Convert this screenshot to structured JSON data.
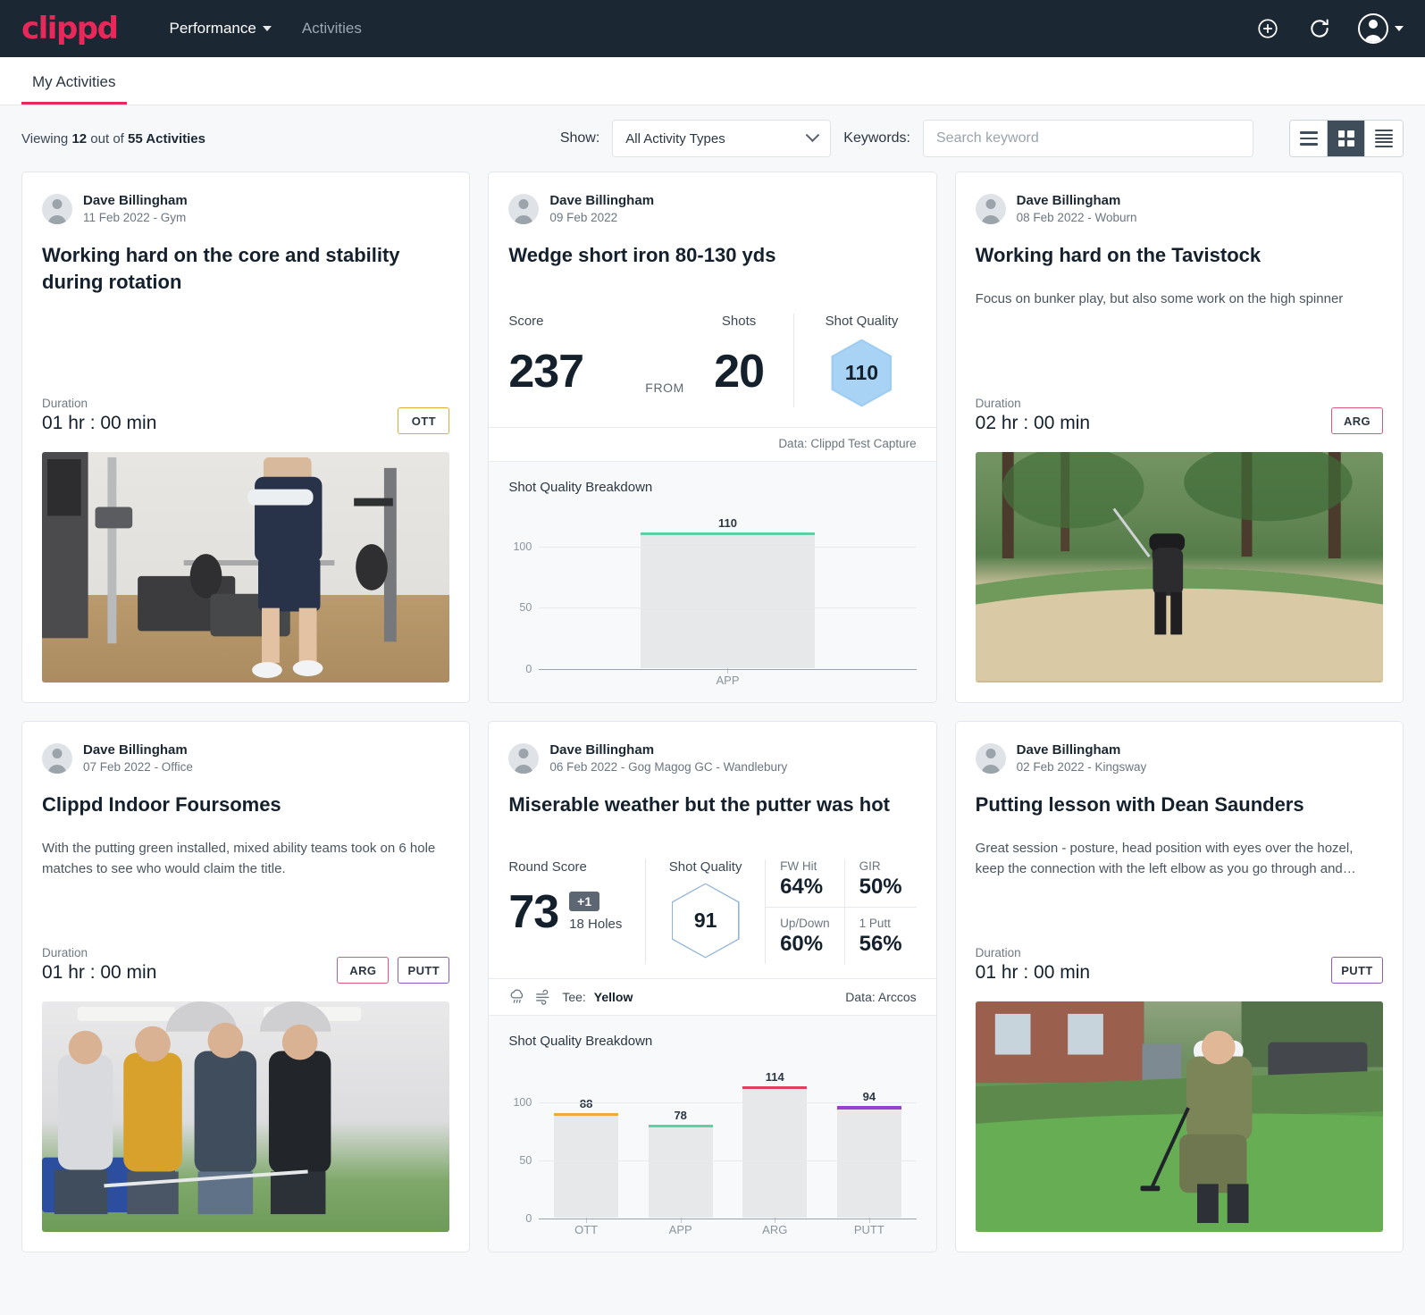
{
  "brand": {
    "logo_text": "clippd",
    "accent": "#e8275a",
    "navbar_bg": "#1b2733"
  },
  "topnav": {
    "links": [
      {
        "label": "Performance",
        "has_dropdown": true
      },
      {
        "label": "Activities",
        "has_dropdown": false
      }
    ],
    "actions": [
      {
        "name": "add-icon",
        "glyph": "plus-circle"
      },
      {
        "name": "refresh-icon",
        "glyph": "refresh"
      },
      {
        "name": "account-menu",
        "glyph": "avatar"
      }
    ]
  },
  "tabs": [
    {
      "label": "My Activities",
      "active": true
    }
  ],
  "filterbar": {
    "viewing_prefix": "Viewing",
    "viewing_count": "12",
    "viewing_mid": "out of",
    "viewing_total": "55 Activities",
    "show_label": "Show:",
    "activity_type_value": "All Activity Types",
    "keywords_label": "Keywords:",
    "search_placeholder": "Search keyword",
    "view_modes": [
      {
        "name": "list-view",
        "active": false
      },
      {
        "name": "grid-view",
        "active": true
      },
      {
        "name": "compact-list-view",
        "active": false
      }
    ]
  },
  "cards": [
    {
      "id": "card-core-stability",
      "author": "Dave Billingham",
      "meta": "11 Feb 2022 - Gym",
      "title": "Working hard on the core and stability during rotation",
      "description": "",
      "duration_label": "Duration",
      "duration_value": "01 hr : 00 min",
      "tags": [
        {
          "label": "OTT",
          "cls": "ott"
        }
      ],
      "photo": "gym",
      "layout": "media"
    },
    {
      "id": "card-wedge-short-iron",
      "author": "Dave Billingham",
      "meta": "09 Feb 2022",
      "title": "Wedge short iron 80-130 yds",
      "layout": "stats",
      "stats": {
        "score_label": "Score",
        "score_value": "237",
        "from_label": "FROM",
        "shots_label": "Shots",
        "shots_value": "20",
        "quality_label": "Shot Quality",
        "quality_value": "110"
      },
      "data_source": "Data: Clippd Test Capture",
      "chart_title": "Shot Quality Breakdown",
      "chart_data": {
        "type": "bar",
        "title": "Shot Quality Breakdown",
        "categories": [
          "APP"
        ],
        "values": [
          110
        ],
        "colors": [
          "#5fd0a5"
        ],
        "ylim": [
          0,
          125
        ],
        "yticks": [
          0,
          50,
          100
        ],
        "xlabel": "",
        "ylabel": "",
        "grid": true,
        "legend": "none"
      }
    },
    {
      "id": "card-tavistock",
      "author": "Dave Billingham",
      "meta": "08 Feb 2022 - Woburn",
      "title": "Working hard on the Tavistock",
      "description": "Focus on bunker play, but also some work on the high spinner",
      "duration_label": "Duration",
      "duration_value": "02 hr : 00 min",
      "tags": [
        {
          "label": "ARG",
          "cls": "arg"
        }
      ],
      "photo": "bunker",
      "layout": "media"
    },
    {
      "id": "card-indoor-foursomes",
      "author": "Dave Billingham",
      "meta": "07 Feb 2022 - Office",
      "title": "Clippd Indoor Foursomes",
      "description": "With the putting green installed, mixed ability teams took on 6 hole matches to see who would claim the title.",
      "duration_label": "Duration",
      "duration_value": "01 hr : 00 min",
      "tags": [
        {
          "label": "ARG",
          "cls": "arg"
        },
        {
          "label": "PUTT",
          "cls": "putt"
        }
      ],
      "photo": "indoor",
      "layout": "media"
    },
    {
      "id": "card-miserable-weather",
      "author": "Dave Billingham",
      "meta": "06 Feb 2022 - Gog Magog GC - Wandlebury",
      "title": "Miserable weather but the putter was hot",
      "layout": "round",
      "round": {
        "score_label": "Round Score",
        "score_value": "73",
        "score_badge": "+1",
        "holes": "18 Holes",
        "quality_label": "Shot Quality",
        "quality_value": "91",
        "metrics": [
          {
            "label": "FW Hit",
            "value": "64%"
          },
          {
            "label": "GIR",
            "value": "50%"
          },
          {
            "label": "Up/Down",
            "value": "60%"
          },
          {
            "label": "1 Putt",
            "value": "56%"
          }
        ]
      },
      "tee_prefix": "Tee:",
      "tee_value": "Yellow",
      "data_source": "Data: Arccos",
      "chart_title": "Shot Quality Breakdown",
      "chart_data": {
        "type": "bar",
        "title": "Shot Quality Breakdown",
        "categories": [
          "OTT",
          "APP",
          "ARG",
          "PUTT"
        ],
        "values": [
          88,
          78,
          114,
          94
        ],
        "colors": [
          "#eeaa3c",
          "#5fd0a5",
          "#e0405e",
          "#9b3fd0"
        ],
        "ylim": [
          0,
          128
        ],
        "yticks": [
          0,
          50,
          100
        ],
        "xlabel": "",
        "ylabel": "",
        "grid": true,
        "legend": "none"
      }
    },
    {
      "id": "card-putting-lesson",
      "author": "Dave Billingham",
      "meta": "02 Feb 2022 - Kingsway",
      "title": "Putting lesson with Dean Saunders",
      "description": "Great session - posture, head position with eyes over the hozel, keep the connection with the left elbow as you go through and…",
      "duration_label": "Duration",
      "duration_value": "01 hr : 00 min",
      "tags": [
        {
          "label": "PUTT",
          "cls": "putt"
        }
      ],
      "photo": "green",
      "layout": "media"
    }
  ]
}
